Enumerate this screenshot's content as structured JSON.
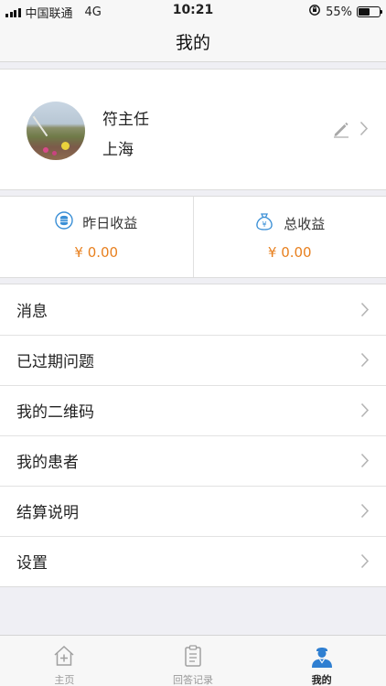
{
  "status_bar": {
    "carrier": "中国联通",
    "network": "4G",
    "time": "10:21",
    "battery": "55%",
    "battery_level": 0.55
  },
  "nav": {
    "title": "我的"
  },
  "profile": {
    "name": "符主任",
    "city": "上海"
  },
  "earnings": {
    "yesterday_label": "昨日收益",
    "yesterday_value": "¥ 0.00",
    "total_label": "总收益",
    "total_value": "¥ 0.00",
    "value_color": "#e8801f",
    "icon_color": "#3a8fd6"
  },
  "menu": {
    "items": [
      {
        "label": "消息"
      },
      {
        "label": "已过期问题"
      },
      {
        "label": "我的二维码"
      },
      {
        "label": "我的患者"
      },
      {
        "label": "结算说明"
      },
      {
        "label": "设置"
      }
    ]
  },
  "tabs": [
    {
      "label": "主页",
      "icon": "home-plus-icon",
      "active": false
    },
    {
      "label": "回答记录",
      "icon": "clipboard-icon",
      "active": false
    },
    {
      "label": "我的",
      "icon": "doctor-icon",
      "active": true
    }
  ]
}
